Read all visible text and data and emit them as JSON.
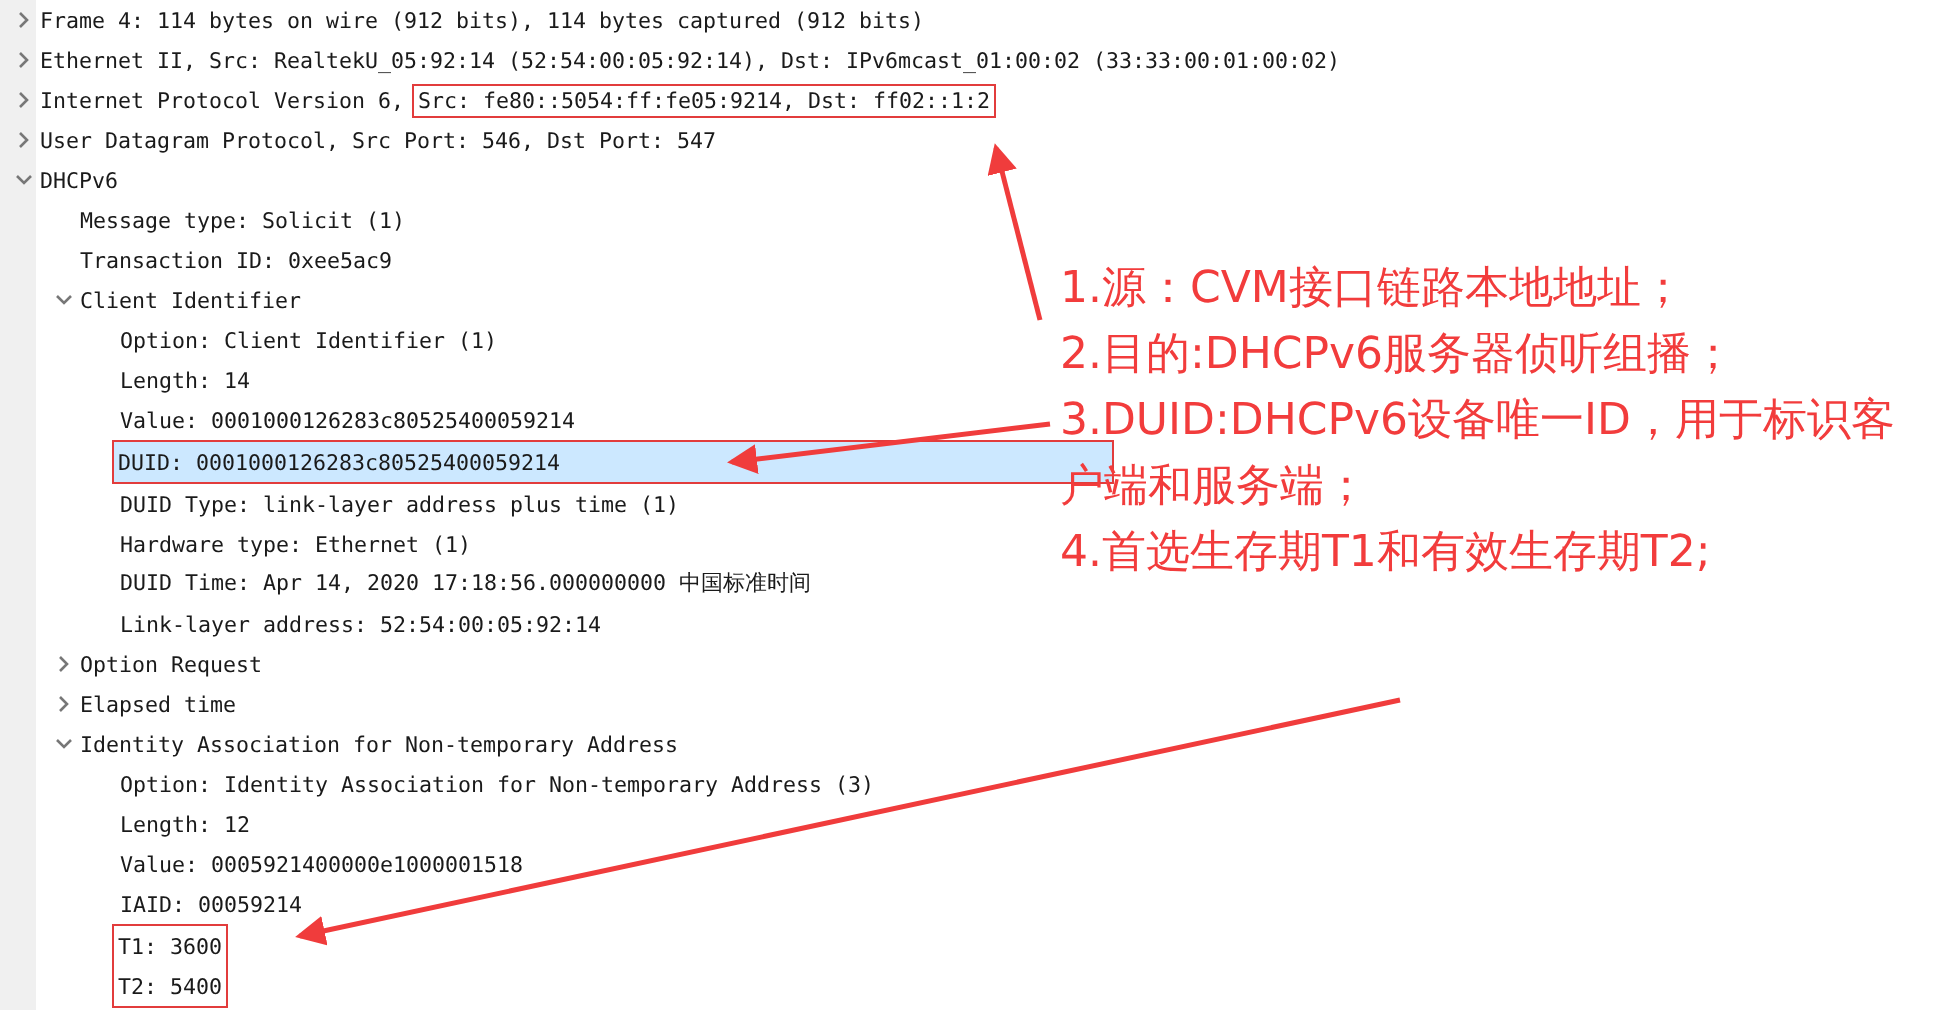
{
  "tree": [
    {
      "label": "Frame 4: 114 bytes on wire (912 bits), 114 bytes captured (912 bits)",
      "expanded": false,
      "selected": false
    },
    {
      "label": "Ethernet II, Src: RealtekU_05:92:14 (52:54:00:05:92:14), Dst: IPv6mcast_01:00:02 (33:33:00:01:00:02)",
      "expanded": false,
      "selected": false
    },
    {
      "label": "Internet Protocol Version 6,",
      "marked_text": "Src: fe80::5054:ff:fe05:9214, Dst: ff02::1:2",
      "expanded": false,
      "selected": false
    },
    {
      "label": "User Datagram Protocol, Src Port: 546, Dst Port: 547",
      "expanded": false,
      "selected": false
    },
    {
      "label": "DHCPv6",
      "expanded": true,
      "selected": false,
      "children": [
        {
          "label": "Message type: Solicit (1)",
          "selected": false
        },
        {
          "label": "Transaction ID: 0xee5ac9",
          "selected": false
        },
        {
          "label": "Client Identifier",
          "expanded": true,
          "selected": false,
          "children": [
            {
              "label": "Option: Client Identifier (1)",
              "selected": false
            },
            {
              "label": "Length: 14",
              "selected": false
            },
            {
              "label": "Value: 0001000126283c80525400059214",
              "selected": false
            },
            {
              "label": "DUID: 0001000126283c80525400059214",
              "selected": true,
              "marked": true
            },
            {
              "label": "DUID Type: link-layer address plus time (1)",
              "selected": false
            },
            {
              "label": "Hardware type: Ethernet (1)",
              "selected": false
            },
            {
              "label": "DUID Time: Apr 14, 2020 17:18:56.000000000 中国标准时间",
              "selected": false
            },
            {
              "label": "Link-layer address: 52:54:00:05:92:14",
              "selected": false
            }
          ]
        },
        {
          "label": "Option Request",
          "expanded": false,
          "selected": false
        },
        {
          "label": "Elapsed time",
          "expanded": false,
          "selected": false
        },
        {
          "label": "Identity Association for Non-temporary Address",
          "expanded": true,
          "selected": false,
          "children": [
            {
              "label": "Option: Identity Association for Non-temporary Address (3)",
              "selected": false
            },
            {
              "label": "Length: 12",
              "selected": false
            },
            {
              "label": "Value: 0005921400000e1000001518",
              "selected": false
            },
            {
              "label": "IAID: 00059214",
              "selected": false
            },
            {
              "label": "T1: 3600",
              "selected": false,
              "marked": true
            },
            {
              "label": "T2: 5400",
              "selected": false,
              "marked": true
            }
          ]
        }
      ]
    }
  ],
  "annotation": [
    "1.源：CVM接口链路本地地址；",
    "2.目的:DHCPv6服务器侦听组播；",
    "3.DUID:DHCPv6设备唯一ID，用于标识客户端和服务端；",
    "4.首选生存期T1和有效生存期T2;"
  ]
}
